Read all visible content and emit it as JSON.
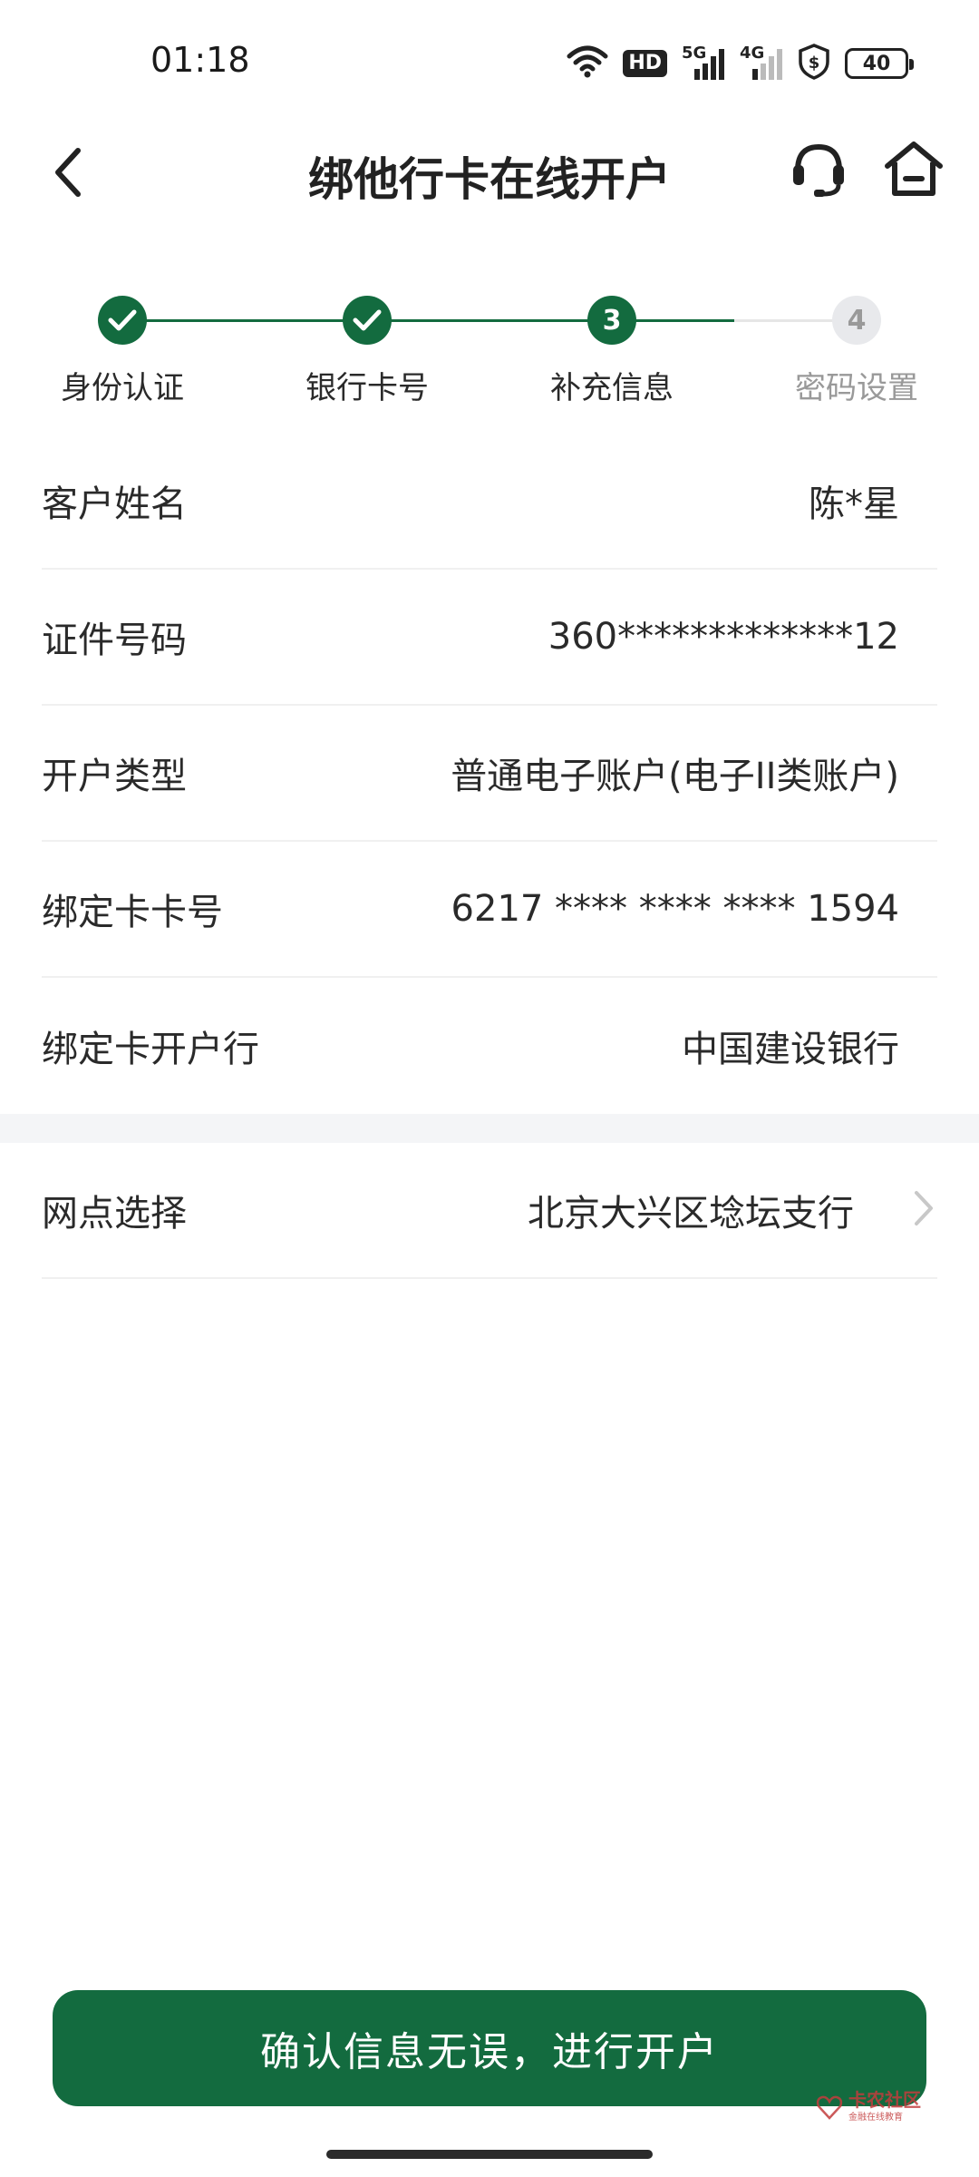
{
  "status_bar": {
    "time": "01:18",
    "hd_label": "HD",
    "signal_1_label": "5G",
    "signal_2_label": "4G",
    "battery_level": "40"
  },
  "nav": {
    "title": "绑他行卡在线开户",
    "back_icon": "chevron-left-icon",
    "service_icon": "headset-icon",
    "home_icon": "home-icon"
  },
  "stepper": {
    "steps": [
      {
        "label": "身份认证",
        "state": "done",
        "number": ""
      },
      {
        "label": "银行卡号",
        "state": "done",
        "number": ""
      },
      {
        "label": "补充信息",
        "state": "current",
        "number": "3"
      },
      {
        "label": "密码设置",
        "state": "pending",
        "number": "4"
      }
    ]
  },
  "info": {
    "rows": [
      {
        "label": "客户姓名",
        "value": "陈*星"
      },
      {
        "label": "证件号码",
        "value": "360*************12"
      },
      {
        "label": "开户类型",
        "value": "普通电子账户(电子II类账户)"
      },
      {
        "label": "绑定卡卡号",
        "value": "6217 **** **** **** 1594"
      },
      {
        "label": "绑定卡开户行",
        "value": "中国建设银行"
      }
    ],
    "branch": {
      "label": "网点选择",
      "value": "北京大兴区埝坛支行"
    }
  },
  "confirm_button": {
    "label": "确认信息无误，进行开户"
  },
  "watermark": {
    "title": "卡农社区",
    "subtitle": "金融在线教育"
  },
  "colors": {
    "primary": "#136b3f",
    "pending": "#e8e9ec",
    "pending_text": "#999999",
    "text": "#2a2a2a"
  }
}
